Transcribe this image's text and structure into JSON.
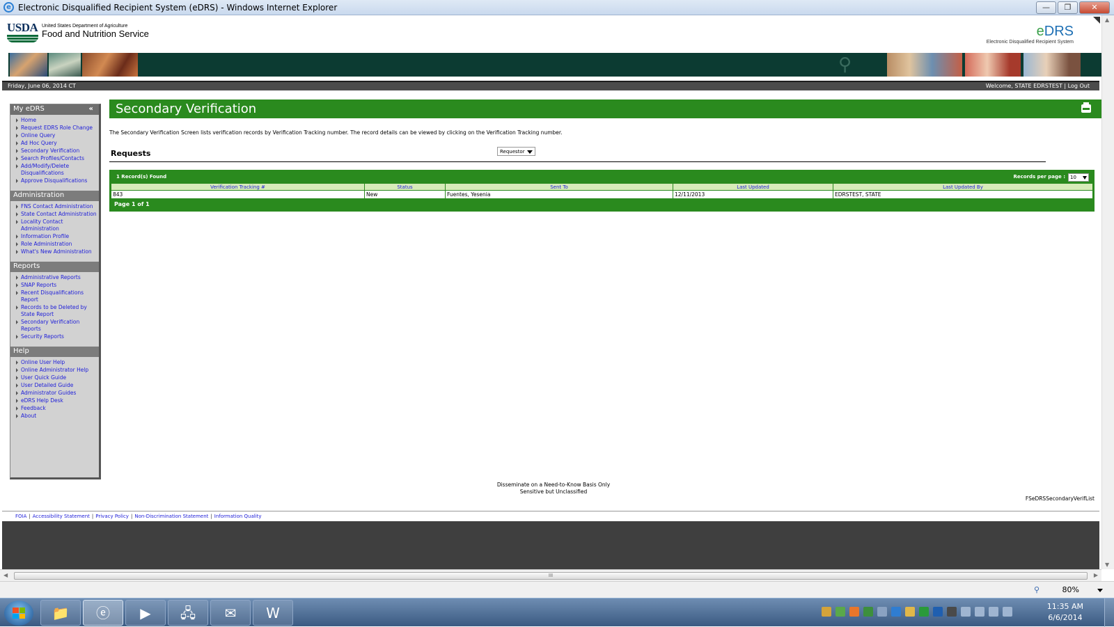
{
  "window": {
    "title": "Electronic Disqualified Recipient System (eDRS) - Windows Internet Explorer",
    "minimize": "—",
    "restore": "❐",
    "close": "✕"
  },
  "header": {
    "usda": "USDA",
    "dept": "United States Department of Agriculture",
    "agency": "Food and Nutrition Service",
    "logo_e": "e",
    "logo_drs": "DRS",
    "logo_sub": "Electronic Disqualified Recipient System"
  },
  "topbar": {
    "date": "Friday, June 06, 2014 CT",
    "welcome": "Welcome, STATE EDRSTEST",
    "separator": "|",
    "logout": "Log Out"
  },
  "sidebar": {
    "sections": [
      {
        "title": "My eDRS",
        "collapse": "«",
        "items": [
          "Home",
          "Request EDRS Role Change",
          "Online Query",
          "Ad Hoc Query",
          "Secondary Verification",
          "Search Profiles/Contacts",
          "Add/Modify/Delete Disqualifications",
          "Approve Disqualifications"
        ]
      },
      {
        "title": "Administration",
        "items": [
          "FNS Contact Administration",
          "State Contact Administration",
          "Locality Contact Administration",
          "Information Profile",
          "Role Administration",
          "What's New Administration"
        ]
      },
      {
        "title": "Reports",
        "items": [
          "Administrative Reports",
          "SNAP Reports",
          "Recent Disqualifications Report",
          "Records to be Deleted by State Report",
          "Secondary Verification Reports",
          "Security Reports"
        ]
      },
      {
        "title": "Help",
        "items": [
          "Online User Help",
          "Online Administrator Help",
          "User Quick Guide",
          "User Detailed Guide",
          "Administrator Guides",
          "eDRS Help Desk",
          "Feedback",
          "About"
        ]
      }
    ]
  },
  "main": {
    "title": "Secondary Verification",
    "description": "The Secondary Verification Screen lists verification records by Verification Tracking number. The record details can be viewed by clicking on the Verification Tracking number.",
    "requests_label": "Requests",
    "requests_select": "Requestor",
    "records_found": "1 Record(s) Found",
    "records_per_page_label": "Records per page :",
    "records_per_page": "10",
    "columns": [
      "Verification Tracking #",
      "Status",
      "Sent To",
      "Last Updated",
      "Last Updated By"
    ],
    "rows": [
      [
        "843",
        "New",
        "Fuentes, Yesenia",
        "12/11/2013",
        "EDRSTEST, STATE"
      ]
    ],
    "pagination": "Page 1 of 1"
  },
  "footer": {
    "disseminate_1": "Disseminate on a Need-to-Know Basis Only",
    "disseminate_2": "Sensitive but Unclassified",
    "page_id": "FSeDRSSecondaryVerifList",
    "links": [
      "FOIA",
      "Accessibility Statement",
      "Privacy Policy",
      "Non-Discrimination Statement",
      "Information Quality"
    ]
  },
  "statusbar": {
    "zoom": "80%"
  },
  "scrollbar": {
    "grip": "III"
  },
  "taskbar": {
    "time": "11:35 AM",
    "date": "6/6/2014"
  }
}
